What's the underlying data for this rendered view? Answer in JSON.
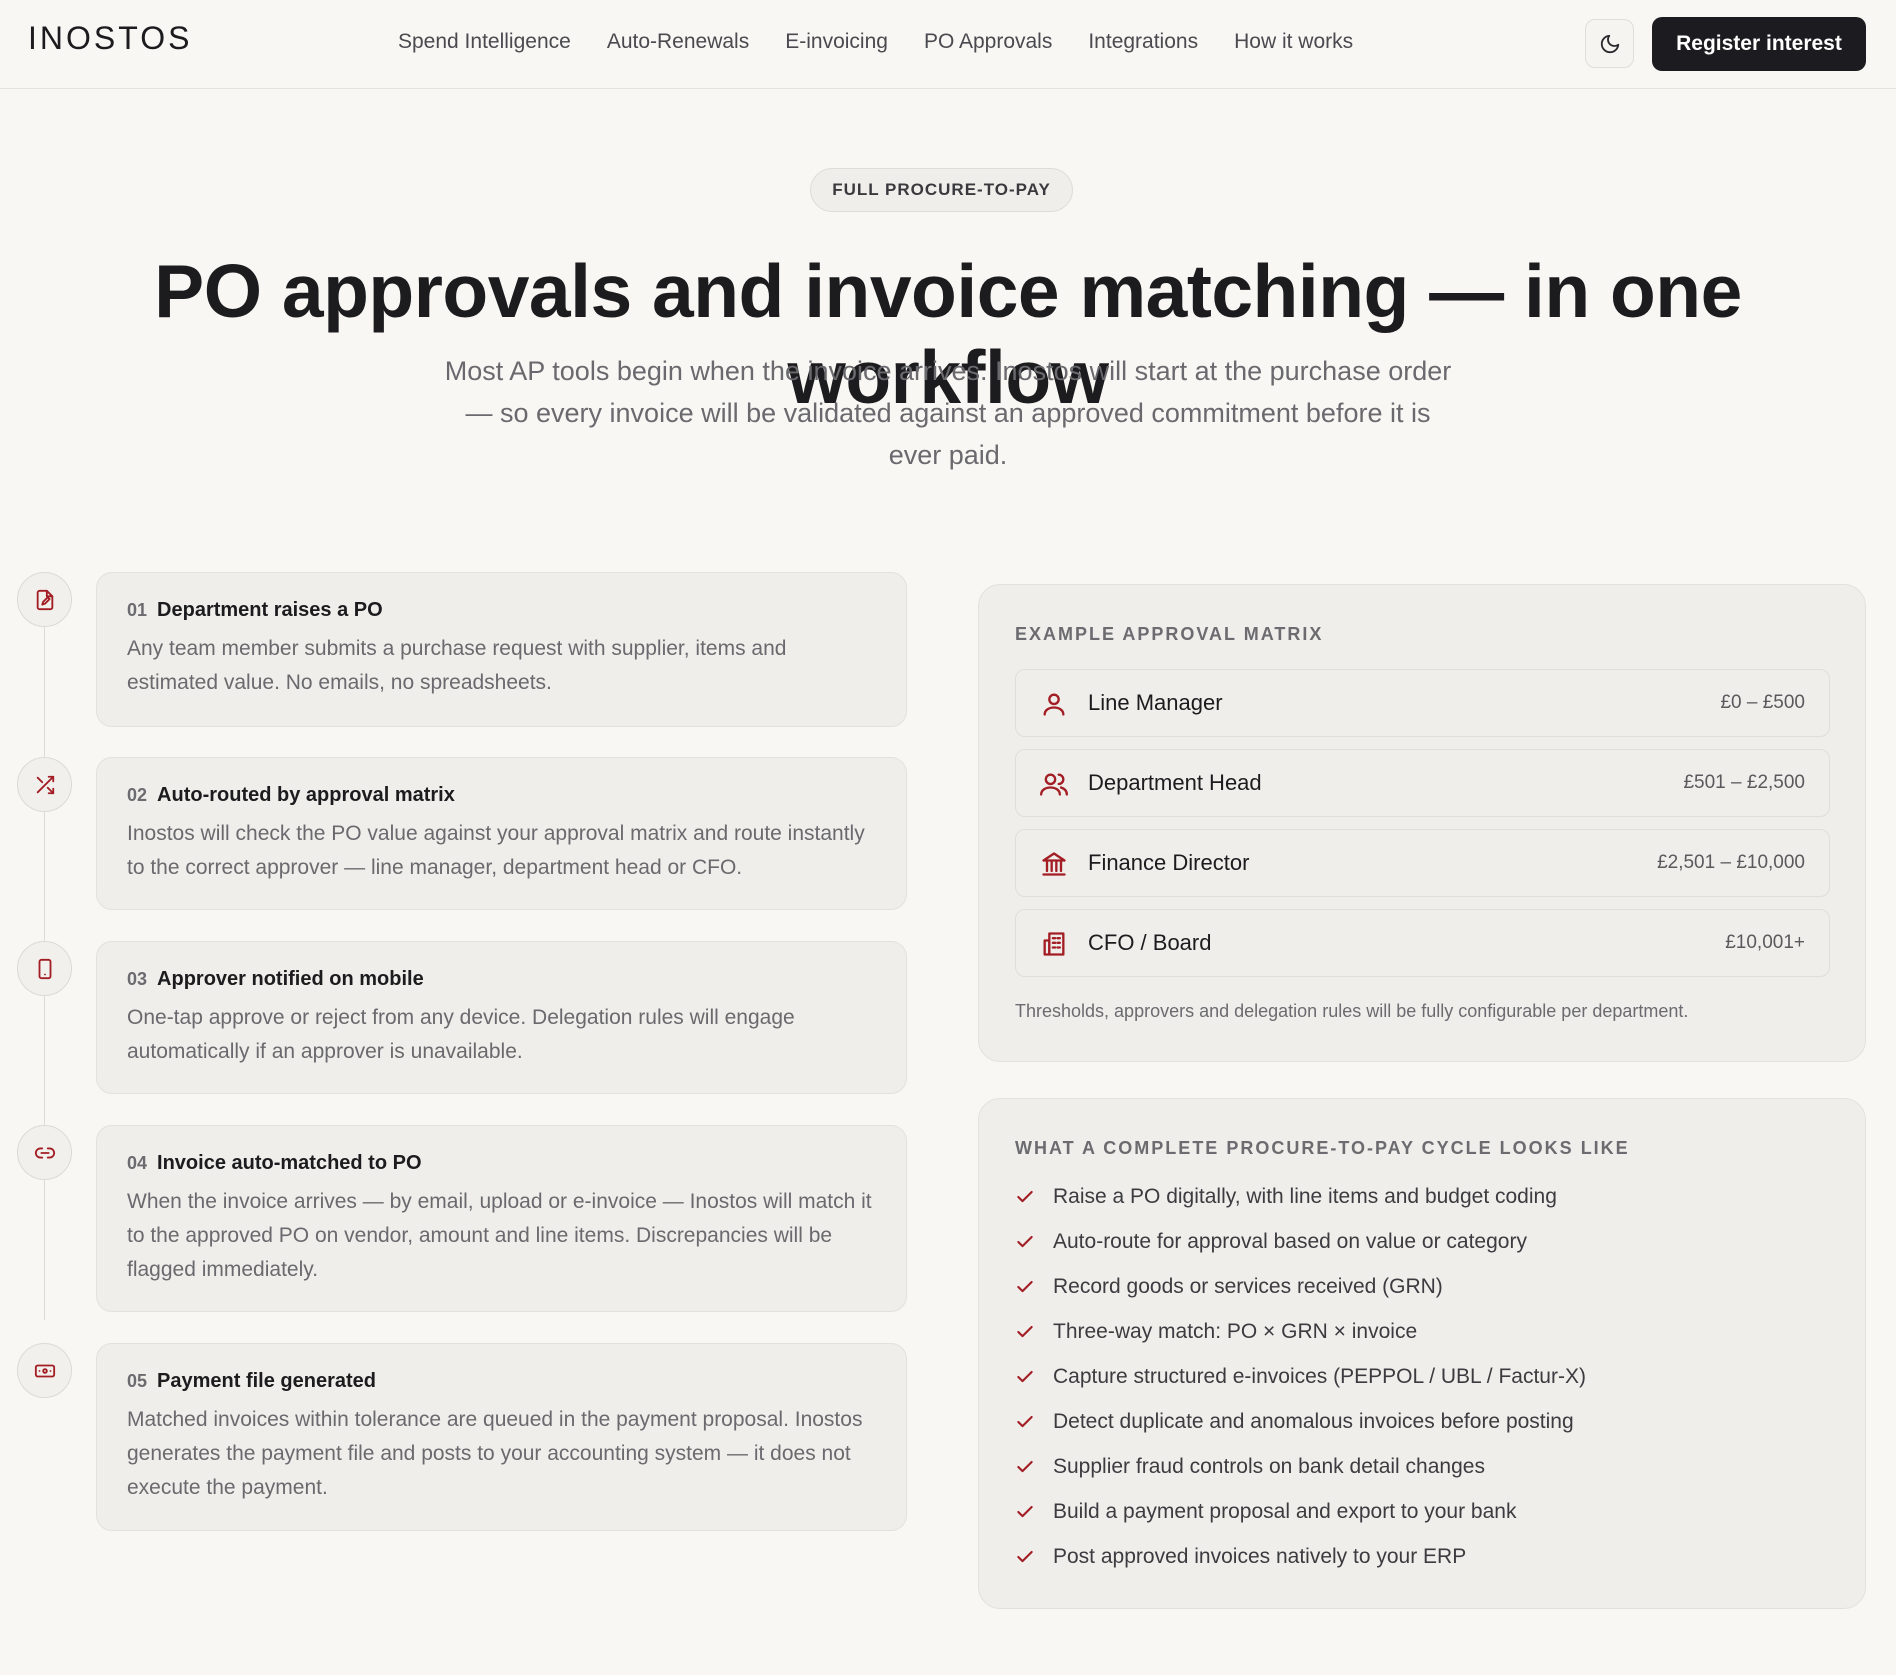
{
  "brand": {
    "logo": "INOSTOS",
    "accent": "#a31d24"
  },
  "nav": [
    "Spend Intelligence",
    "Auto-Renewals",
    "E-invoicing",
    "PO Approvals",
    "Integrations",
    "How it works"
  ],
  "header": {
    "theme_toggle_icon": "moon-icon",
    "cta_label": "Register interest"
  },
  "hero": {
    "pill": "FULL PROCURE-TO-PAY",
    "title": "PO approvals and invoice matching — in one workflow",
    "subtitle": "Most AP tools begin when the invoice arrives. Inostos will start at the purchase order — so every invoice will be validated against an approved commitment before it is ever paid."
  },
  "steps": [
    {
      "num": "01",
      "title": "Department raises a PO",
      "icon": "document-edit-icon",
      "body": "Any team member submits a purchase request with supplier, items and estimated value. No emails, no spreadsheets."
    },
    {
      "num": "02",
      "title": "Auto-routed by approval matrix",
      "icon": "shuffle-icon",
      "body": "Inostos will check the PO value against your approval matrix and route instantly to the correct approver — line manager, department head or CFO."
    },
    {
      "num": "03",
      "title": "Approver notified on mobile",
      "icon": "smartphone-icon",
      "body": "One-tap approve or reject from any device. Delegation rules will engage automatically if an approver is unavailable."
    },
    {
      "num": "04",
      "title": "Invoice auto-matched to PO",
      "icon": "link-icon",
      "body": "When the invoice arrives — by email, upload or e-invoice — Inostos will match it to the approved PO on vendor, amount and line items. Discrepancies will be flagged immediately."
    },
    {
      "num": "05",
      "title": "Payment file generated",
      "icon": "banknote-icon",
      "body": "Matched invoices within tolerance are queued in the payment proposal. Inostos generates the payment file and posts to your accounting system — it does not execute the payment."
    }
  ],
  "matrix": {
    "heading": "EXAMPLE APPROVAL MATRIX",
    "rows": [
      {
        "role": "Line Manager",
        "range": "£0 – £500",
        "icon": "user-icon"
      },
      {
        "role": "Department Head",
        "range": "£501 – £2,500",
        "icon": "users-icon"
      },
      {
        "role": "Finance Director",
        "range": "£2,501 – £10,000",
        "icon": "bank-icon"
      },
      {
        "role": "CFO / Board",
        "range": "£10,001+",
        "icon": "building-icon"
      }
    ],
    "note": "Thresholds, approvers and delegation rules will be fully configurable per department."
  },
  "cycle": {
    "heading": "WHAT A COMPLETE PROCURE-TO-PAY CYCLE LOOKS LIKE",
    "items": [
      "Raise a PO digitally, with line items and budget coding",
      "Auto-route for approval based on value or category",
      "Record goods or services received (GRN)",
      "Three-way match: PO × GRN × invoice",
      "Capture structured e-invoices (PEPPOL / UBL / Factur-X)",
      "Detect duplicate and anomalous invoices before posting",
      "Supplier fraud controls on bank detail changes",
      "Build a payment proposal and export to your bank",
      "Post approved invoices natively to your ERP"
    ]
  }
}
